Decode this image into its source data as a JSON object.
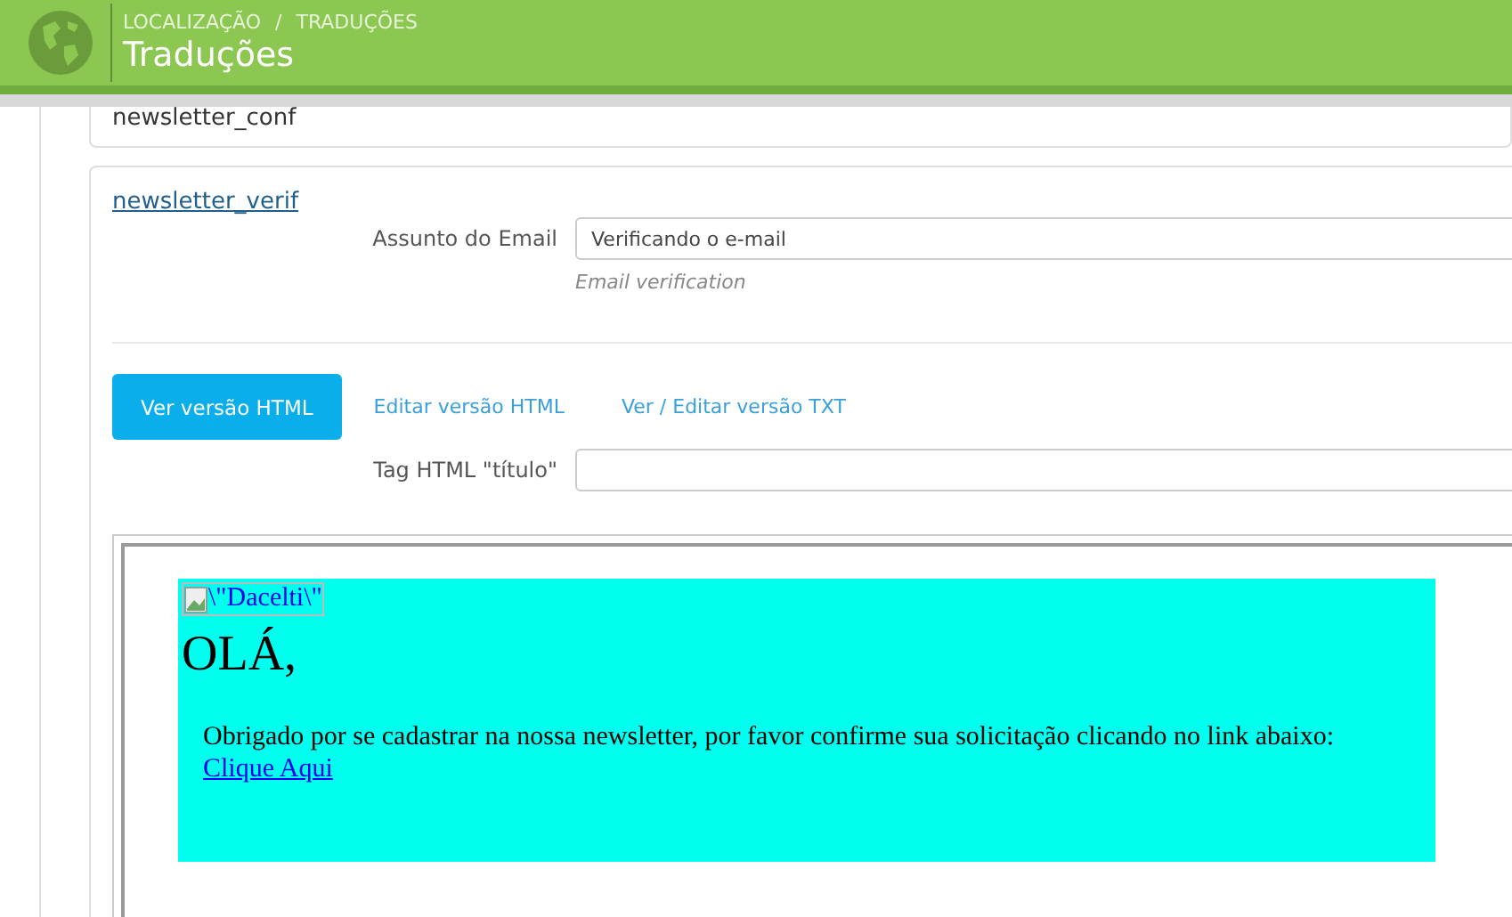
{
  "header": {
    "breadcrumb": [
      "LOCALIZAÇÃO",
      "TRADUÇÕES"
    ],
    "separator": "/",
    "title": "Traduções"
  },
  "cards": [
    {
      "key": "newsletter_conf"
    },
    {
      "key": "newsletter_verif",
      "fields": [
        {
          "label": "Assunto do Email",
          "value": "Verificando o e-mail",
          "hint": "Email verification"
        }
      ],
      "tabs": [
        {
          "label": "Ver versão HTML",
          "selected": true
        },
        {
          "label": "Editar versão HTML",
          "selected": false
        },
        {
          "label": "Ver / Editar versão TXT",
          "selected": false
        }
      ],
      "title_tag": {
        "label": "Tag HTML \"título\""
      },
      "preview": {
        "image_alt": "\\\"Dacelti\\\"",
        "greeting": "OLÁ,",
        "message": "Obrigado por se cadastrar na nossa newsletter, por favor confirme sua solicitação clicando no link abaixo:",
        "link": "Clique Aqui"
      }
    }
  ]
}
